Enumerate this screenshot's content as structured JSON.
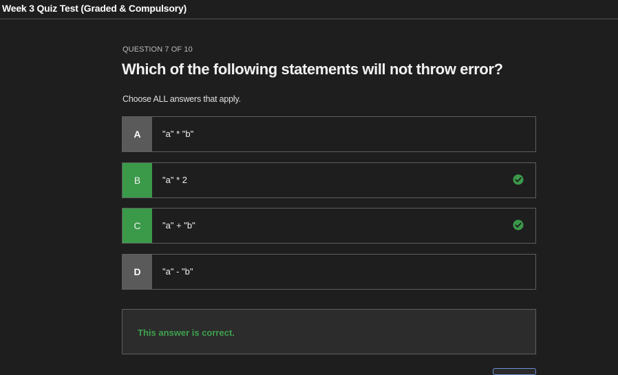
{
  "header": {
    "title": "Week 3 Quiz Test (Graded & Compulsory)"
  },
  "quiz": {
    "counter": "QUESTION 7 OF 10",
    "question": "Which of the following statements will not throw error?",
    "instruction": "Choose ALL answers that apply.",
    "options": [
      {
        "letter": "A",
        "text": "\"a\" * \"b\"",
        "correct": false
      },
      {
        "letter": "B",
        "text": "\"a\" * 2",
        "correct": true
      },
      {
        "letter": "C",
        "text": "\"a\" + \"b\"",
        "correct": true
      },
      {
        "letter": "D",
        "text": "\"a\" - \"b\"",
        "correct": false
      }
    ],
    "feedback": "This answer is correct."
  },
  "icons": {
    "correct": "check-circle-icon"
  },
  "colors": {
    "correct_green": "#3a9a4a",
    "feedback_green": "#3fa14e",
    "neutral_letter_bg": "#5a5a5a",
    "background": "#1e1e1e"
  }
}
